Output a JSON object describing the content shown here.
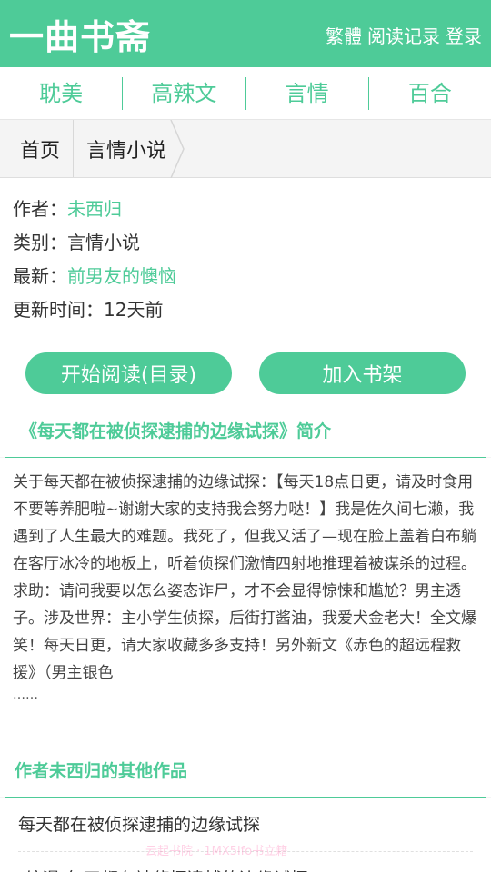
{
  "header": {
    "logo": "一曲书斋",
    "links": [
      "繁體",
      "阅读记录",
      "登录"
    ]
  },
  "categories": [
    "耽美",
    "高辣文",
    "言情",
    "百合"
  ],
  "breadcrumb": [
    "首页",
    "言情小说"
  ],
  "info": {
    "author_label": "作者：",
    "author": "未西归",
    "category_label": "类别：",
    "category": "言情小说",
    "latest_label": "最新：",
    "latest": "前男友的懊恼",
    "updated_label": "更新时间：",
    "updated": "12天前"
  },
  "buttons": {
    "read": "开始阅读(目录)",
    "shelf": "加入书架"
  },
  "intro": {
    "title": "《每天都在被侦探逮捕的边缘试探》简介",
    "text": "关于每天都在被侦探逮捕的边缘试探：【每天18点日更，请及时食用不要等养肥啦~谢谢大家的支持我会努力哒！】我是佐久间七濑，我遇到了人生最大的难题。我死了，但我又活了—现在脸上盖着白布躺在客厅冰冷的地板上，听着侦探们激情四射地推理着被谋杀的过程。求助：请问我要以怎么姿态诈尸，才不会显得惊悚和尴尬？男主透子。涉及世界：主小学生侦探，后街打酱油，我爱犬金老大！全文爆笑！每天日更，请大家收藏多多支持！另外新文《赤色的超远程救援》（男主银色",
    "ellipsis": "……"
  },
  "works": {
    "title": "作者未西归的其他作品",
    "items": [
      "每天都在被侦探逮捕的边缘试探",
      "[综漫]每天都在被侦探逮捕的边缘试探"
    ]
  },
  "watermark": "云起书院 · 1MX5lfo书立籍",
  "colors": {
    "accent": "#4ecb98",
    "background": "#f4f4f4"
  }
}
